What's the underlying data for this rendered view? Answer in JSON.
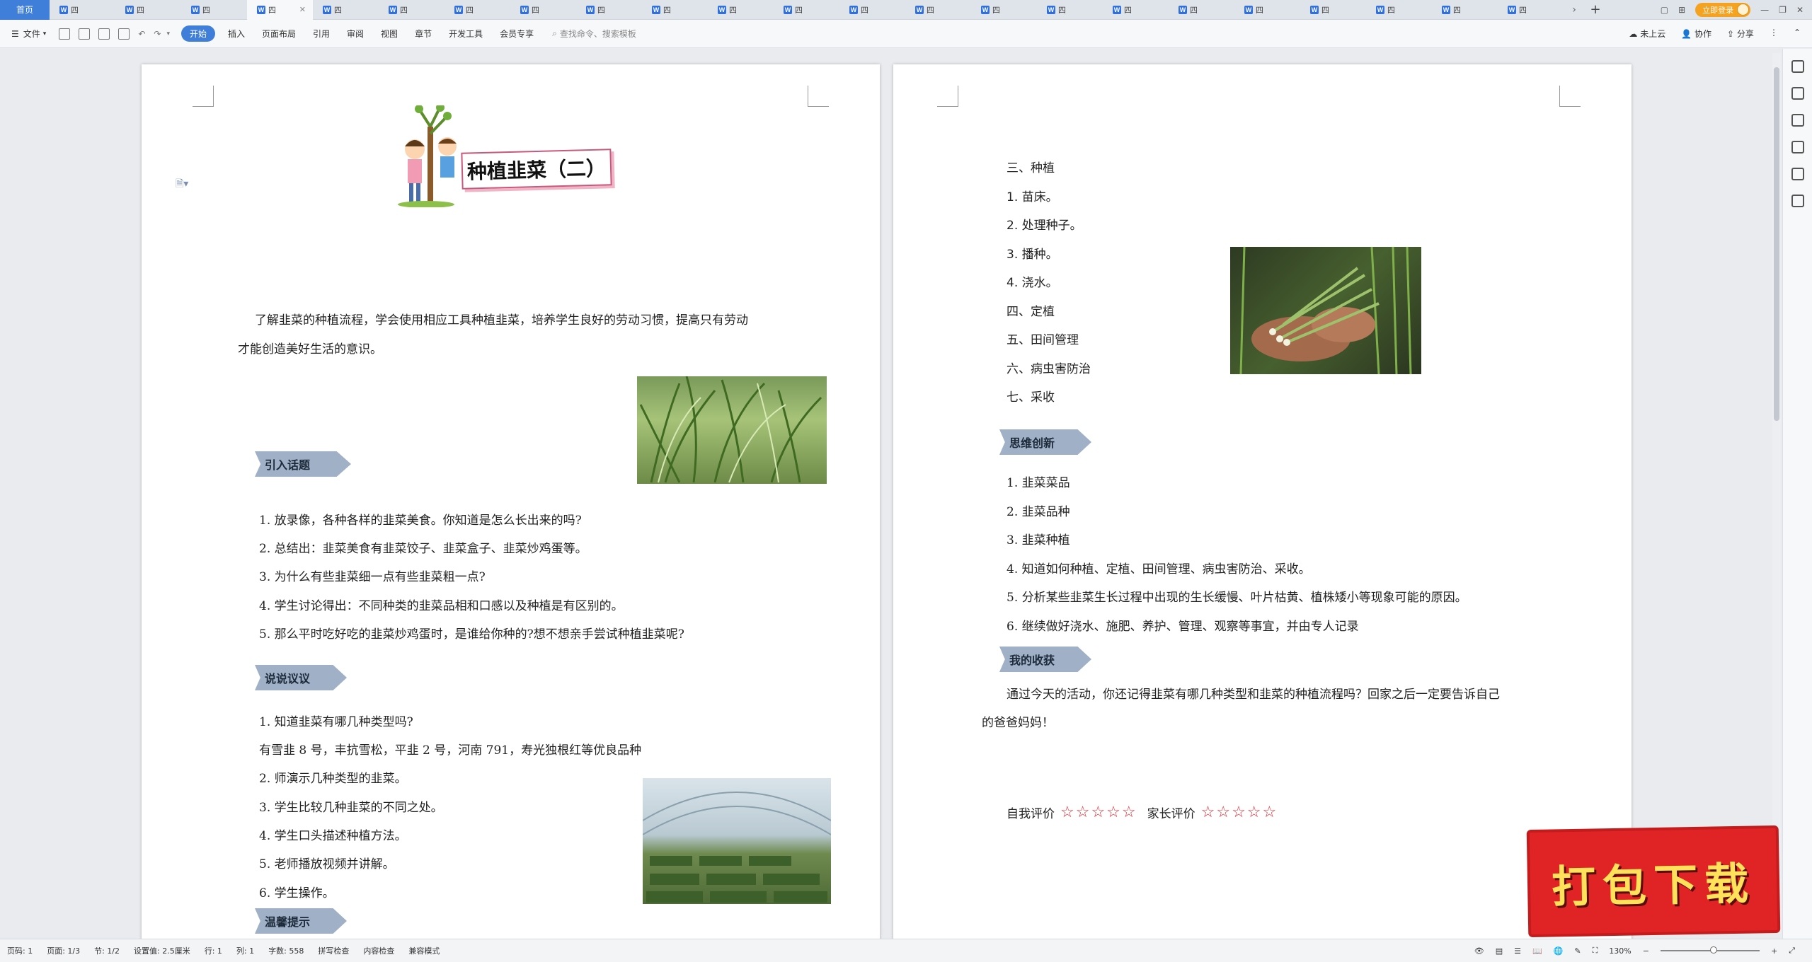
{
  "tabbar": {
    "home": "首页",
    "doc_tab_label": "四",
    "tab_count": 23,
    "active_index": 3,
    "login": "立即登录"
  },
  "menubar": {
    "file": "文件",
    "tabs": [
      "开始",
      "插入",
      "页面布局",
      "引用",
      "审阅",
      "视图",
      "章节",
      "开发工具",
      "会员专享"
    ],
    "search_placeholder": "查找命令、搜索模板",
    "right": [
      "未上云",
      "协作",
      "分享"
    ]
  },
  "left_page": {
    "title": "种植韭菜（二）",
    "intro_line1": "了解韭菜的种植流程，学会使用相应工具种植韭菜，培养学生良好的劳动习惯，提高只有劳动",
    "intro_line2": "才能创造美好生活的意识。",
    "section1": "引入话题",
    "s1_items": [
      "1. 放录像，各种各样的韭菜美食。你知道是怎么长出来的吗?",
      "2. 总结出：韭菜美食有韭菜饺子、韭菜盒子、韭菜炒鸡蛋等。",
      "3. 为什么有些韭菜细一点有些韭菜粗一点?",
      "4. 学生讨论得出：不同种类的韭菜品相和口感以及种植是有区别的。",
      "5. 那么平时吃好吃的韭菜炒鸡蛋时，是谁给你种的?想不想亲手尝试种植韭菜呢?"
    ],
    "section2": "说说议议",
    "s2_items": [
      "1. 知道韭菜有哪几种类型吗?",
      "有雪韭 8 号，丰抗雪松，平韭 2 号，河南 791，寿光独根红等优良品种",
      " 2. 师演示几种类型的韭菜。",
      "3. 学生比较几种韭菜的不同之处。",
      "4. 学生口头描述种植方法。",
      "5. 老师播放视频并讲解。",
      "6. 学生操作。"
    ],
    "section3": "温馨提示"
  },
  "right_page": {
    "steps": [
      "三、种植",
      "1. 苗床。",
      "2. 处理种子。",
      "3. 播种。",
      "4. 浇水。",
      "四、定植",
      "五、田间管理",
      "六、病虫害防治",
      "七、采收"
    ],
    "section4": "思维创新",
    "s4_items": [
      "1. 韭菜菜品",
      " 2. 韭菜品种",
      "3. 韭菜种植",
      "4. 知道如何种植、定植、田间管理、病虫害防治、采收。",
      "5. 分析某些韭菜生长过程中出现的生长缓慢、叶片枯黄、植株矮小等现象可能的原因。",
      "6. 继续做好浇水、施肥、养护、管理、观察等事宜，并由专人记录"
    ],
    "section5": "我的收获",
    "harvest_line1": "通过今天的活动，你还记得韭菜有哪几种类型和韭菜的种植流程吗？回家之后一定要告诉自己",
    "harvest_line2": "的爸爸妈妈！",
    "self_eval": "自我评价",
    "parent_eval": "家长评价",
    "stars": "☆☆☆☆☆"
  },
  "statusbar": {
    "items": [
      "页码: 1",
      "页面: 1/3",
      "节: 1/2",
      "设置值: 2.5厘米",
      "行: 1",
      "列: 1",
      "字数: 558",
      "拼写检查",
      "内容检查",
      "兼容模式"
    ],
    "zoom": "130%"
  },
  "banner": "打包下载",
  "colors": {
    "accent": "#3f7fd9",
    "section_label": "#9fb0c7",
    "stars": "#e2303a",
    "banner": "#e02426"
  }
}
